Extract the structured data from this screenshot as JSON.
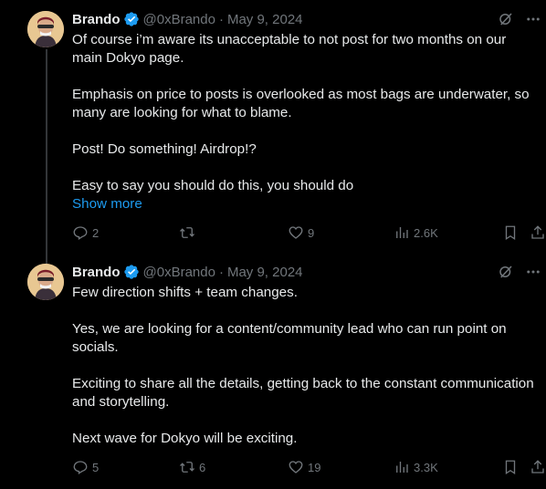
{
  "colors": {
    "background": "#000000",
    "text": "#e7e9ea",
    "muted": "#71767b",
    "link": "#1d9bf0",
    "verified": "#1d9bf0"
  },
  "tweets": [
    {
      "author": {
        "name": "Brando",
        "handle": "@0xBrando",
        "verified": true,
        "avatar_icon": "avatar-icon"
      },
      "separator": "·",
      "date": "May 9, 2024",
      "paragraphs": [
        "Of course i’m aware its unacceptable to not post for two months on our main Dokyo page.",
        "Emphasis on price to posts is overlooked as most bags are underwater, so many are looking for what to blame.",
        "Post! Do something! Airdrop!?",
        "Easy to say you should do this, you should do"
      ],
      "show_more": "Show more",
      "actions": {
        "replies": "2",
        "reposts": "",
        "likes": "9",
        "views": "2.6K"
      }
    },
    {
      "author": {
        "name": "Brando",
        "handle": "@0xBrando",
        "verified": true,
        "avatar_icon": "avatar-icon"
      },
      "separator": "·",
      "date": "May 9, 2024",
      "paragraphs": [
        "Few direction shifts + team changes.",
        "Yes, we are looking for a content/community lead who can run point on socials.",
        "Exciting to share all the details, getting back to the constant communication and storytelling.",
        "Next wave for Dokyo will be exciting."
      ],
      "show_more": "",
      "actions": {
        "replies": "5",
        "reposts": "6",
        "likes": "19",
        "views": "3.3K"
      }
    }
  ],
  "icons": {
    "grok": "grok-icon",
    "more": "more-icon",
    "reply": "reply-icon",
    "repost": "repost-icon",
    "like": "heart-icon",
    "views": "views-icon",
    "bookmark": "bookmark-icon",
    "share": "share-icon"
  }
}
